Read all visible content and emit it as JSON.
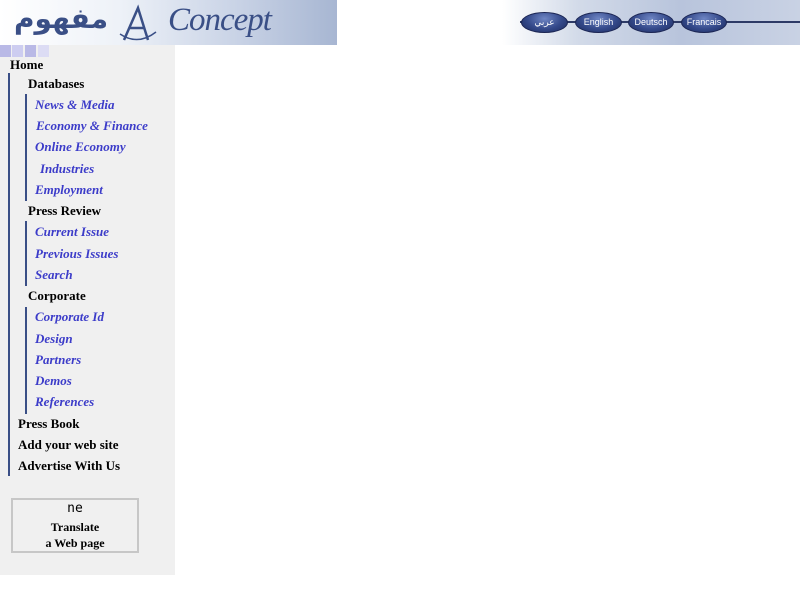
{
  "header": {
    "logo_arabic": "مفهوم",
    "logo_text": "Concept",
    "languages": [
      "عربي",
      "English",
      "Deutsch",
      "Francais"
    ]
  },
  "nav": {
    "home": "Home",
    "sections": [
      {
        "title": "Databases",
        "links": [
          "News & Media",
          "Economy & Finance",
          "Online Economy",
          "Industries",
          "Employment"
        ]
      },
      {
        "title": "Press Review",
        "links": [
          "Current Issue",
          "Previous Issues",
          "Search"
        ]
      },
      {
        "title": "Corporate",
        "links": [
          "Corporate Id",
          "Design",
          "Partners",
          "Demos",
          "References"
        ]
      }
    ],
    "top_links": [
      "Press Book",
      "Add your web site",
      "Advertise With Us"
    ]
  },
  "translate": {
    "icon_text": "ne",
    "label": "Translate\na Web page"
  },
  "colors": {
    "nav_link": "#3c3cc9",
    "accent": "#3a4f86",
    "sidebar_bg": "#f0f0f0"
  }
}
